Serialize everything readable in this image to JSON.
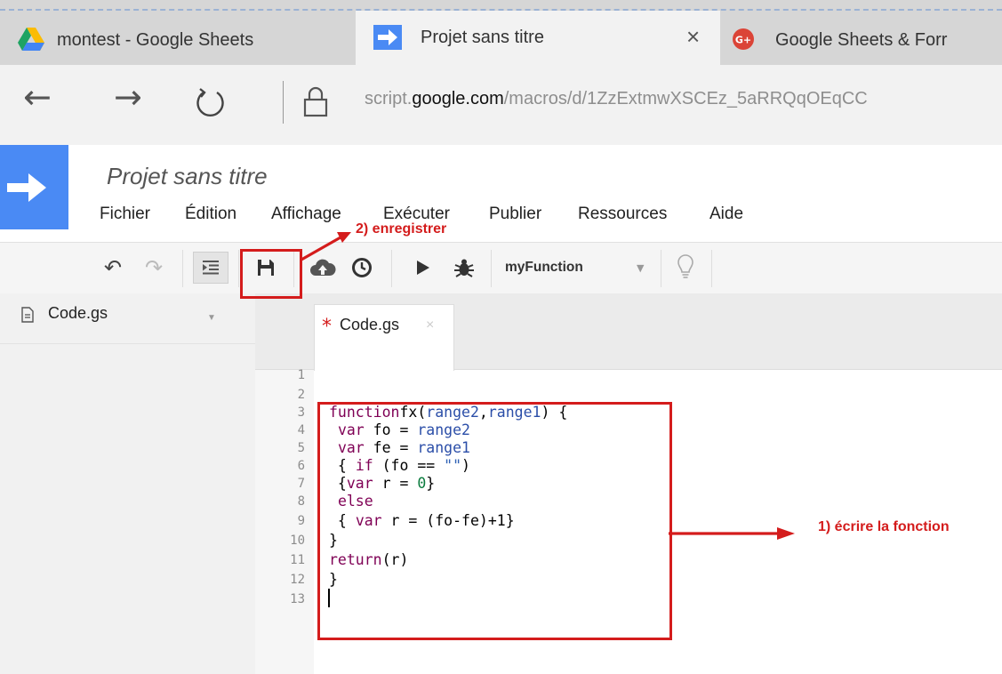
{
  "browser": {
    "tabs": [
      {
        "title": "montest - Google Sheets",
        "icon": "google-drive-icon"
      },
      {
        "title": "Projet sans titre",
        "icon": "apps-script-icon",
        "active": true,
        "close": "×"
      },
      {
        "title": "Google Sheets & Forr",
        "icon": "google-plus-icon"
      }
    ],
    "url": {
      "sub": "script.",
      "domain": "google.com",
      "path": "/macros/d/1ZzExtmwXSCEz_5aRRQqOEqCC"
    }
  },
  "app": {
    "project_title": "Projet sans titre",
    "menu": [
      "Fichier",
      "Édition",
      "Affichage",
      "Exécuter",
      "Publier",
      "Ressources",
      "Aide"
    ],
    "function_select": "myFunction"
  },
  "files": [
    {
      "name": "Code.gs"
    }
  ],
  "editor": {
    "tab": {
      "modified_mark": "*",
      "name": "Code.gs",
      "close": "×"
    },
    "line_numbers": [
      "1",
      "2",
      "3",
      "4",
      "5",
      "6",
      "7",
      "8",
      "9",
      "10",
      "11",
      "12",
      "13"
    ]
  },
  "annotations": {
    "save": "2) enregistrer",
    "write": "1) écrire la fonction"
  },
  "colors": {
    "annotation": "#d41c1c",
    "brand": "#4a8af4"
  }
}
